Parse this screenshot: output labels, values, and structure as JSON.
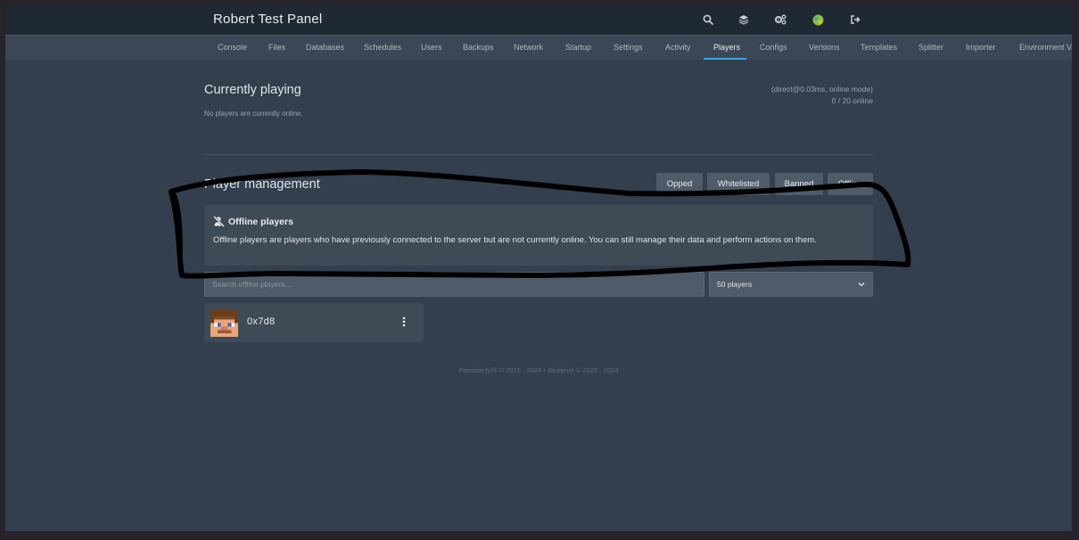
{
  "header": {
    "title": "Robert Test Panel",
    "icons": [
      "search-icon",
      "layers-icon",
      "cogs-icon",
      "avatar-icon",
      "logout-icon"
    ]
  },
  "tabs": [
    {
      "label": "Console"
    },
    {
      "label": "Files"
    },
    {
      "label": "Databases"
    },
    {
      "label": "Schedules"
    },
    {
      "label": "Users"
    },
    {
      "label": "Backups"
    },
    {
      "label": "Network"
    },
    {
      "label": "Startup"
    },
    {
      "label": "Settings"
    },
    {
      "label": "Activity"
    },
    {
      "label": "Players",
      "active": true
    },
    {
      "label": "Configs"
    },
    {
      "label": "Versions"
    },
    {
      "label": "Templates"
    },
    {
      "label": "Splitter"
    },
    {
      "label": "Importer"
    },
    {
      "label": "Environment Va"
    }
  ],
  "current": {
    "title": "Currently playing",
    "empty_text": "No players are currently online.",
    "status": "(direct@0.03ms, online mode)",
    "online": "0 / 20 online"
  },
  "management": {
    "title": "Player management",
    "buttons": [
      "Opped",
      "Whitelisted",
      "Banned",
      "Offline"
    ],
    "info_title": "Offline players",
    "info_body": "Offline players are players who have previously connected to the server but are not currently online. You can still manage their data and perform actions on them.",
    "search_placeholder": "Search offline players...",
    "page_size": "50 players"
  },
  "players": [
    {
      "name": "0x7d8"
    }
  ],
  "footer": "Pterodactyl® © 2015 - 2024  •  Blueprint © 2023 - 2024",
  "colors": {
    "accent": "#3fa9e6",
    "background": "#333f4d",
    "topbar": "#1f2933",
    "scribble": "#000000"
  }
}
